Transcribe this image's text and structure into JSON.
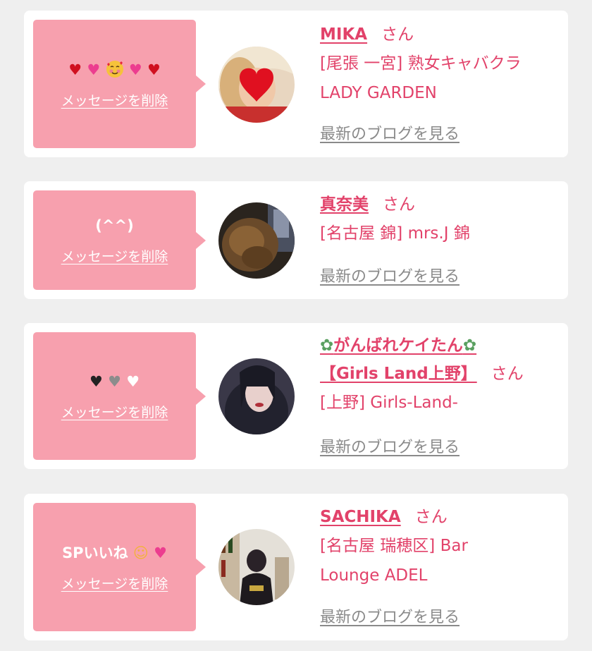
{
  "delete_label": "メッセージを削除",
  "blog_label": "最新のブログを見る",
  "san_label": "さん",
  "cards": [
    {
      "message_icons": [
        "heart-icon",
        "two-hearts-icon",
        "smiling-face-with-hearts-icon",
        "two-hearts-icon",
        "heart-icon"
      ],
      "name": "MIKA",
      "shop_line1": "[尾張 一宮] 熟女キャバクラ",
      "shop_line2": "LADY GARDEN"
    },
    {
      "message": "(^^)",
      "name": "真奈美",
      "shop_line1": "[名古屋 錦] mrs.J 錦"
    },
    {
      "message_icons": [
        "black-heart-icon",
        "grey-heart-icon",
        "white-heart-icon"
      ],
      "name_prefix_icon": "fairy-icon",
      "name_line1": "がんばれケイたん",
      "name_suffix_icon": "fairy-icon",
      "name_line2": "【Girls Land上野】",
      "shop_line1": "[上野] Girls-Land-"
    },
    {
      "message": "SPいいね",
      "message_icons": [
        "baby-angel-icon",
        "heart-with-ribbon-icon"
      ],
      "name": "SACHIKA",
      "shop_line1": "[名古屋 瑞穂区] Bar",
      "shop_line2": "Lounge ADEL"
    }
  ],
  "colors": {
    "page_bg": "#efefef",
    "card_bg": "#ffffff",
    "bubble": "#f7a0ae",
    "accent_text": "#e2426a",
    "link_grey": "#8a8a8a"
  }
}
